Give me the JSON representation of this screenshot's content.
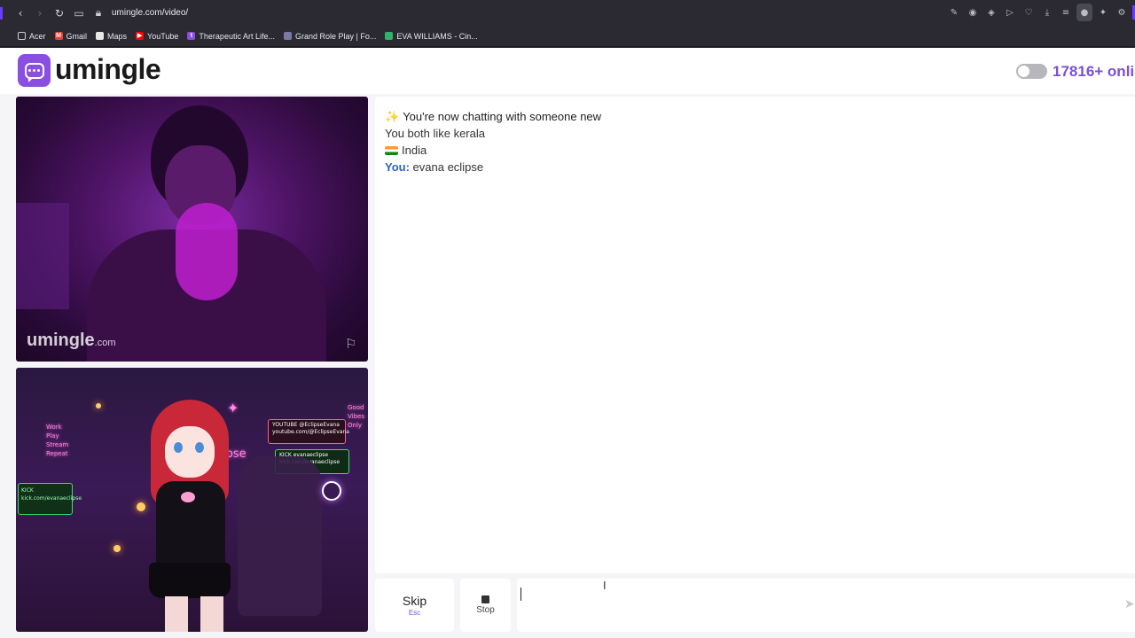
{
  "browser": {
    "url": "umingle.com/video/",
    "nav": {
      "back": "‹",
      "forward": "›",
      "reload": "↻"
    },
    "bookmarks": [
      {
        "label": "Acer",
        "icon": "folder-icon"
      },
      {
        "label": "Gmail",
        "icon": "gmail-icon"
      },
      {
        "label": "Maps",
        "icon": "maps-icon"
      },
      {
        "label": "YouTube",
        "icon": "youtube-icon"
      },
      {
        "label": "Therapeutic Art Life...",
        "icon": "site-icon"
      },
      {
        "label": "Grand Role Play | Fo...",
        "icon": "site-icon"
      },
      {
        "label": "EVA WILLIAMS - Cin...",
        "icon": "site-icon"
      }
    ]
  },
  "header": {
    "brand": "umingle",
    "online_count": "17816+ onli",
    "accent_color": "#7b4fd6"
  },
  "video": {
    "watermark": "umingle",
    "watermark_suffix": ".com",
    "report_icon": "flag-icon"
  },
  "chat": {
    "messages": [
      {
        "text": "You're now chatting with someone new",
        "icon": "sparkle-icon"
      },
      {
        "text": "You both like kerala"
      },
      {
        "text": "India",
        "icon": "india-flag-icon"
      },
      {
        "speaker": "You:",
        "text": "evana eclipse"
      }
    ]
  },
  "controls": {
    "skip_label": "Skip",
    "skip_hint": "Esc",
    "stop_label": "Stop",
    "input_value": ""
  },
  "overlay_text": {
    "youtube_panel": "YOUTUBE @EclipseEvana youtube.com/@EclipseEvana",
    "kick_panel": "KICK evanaeclipse kick.com/evanaeclipse",
    "kick_left": "KICK kick.com/evanaeclipse",
    "neon_left": "Work Play Stream Repeat",
    "neon_right": "Good Vibes Only",
    "neon_center": "Eclipse"
  }
}
